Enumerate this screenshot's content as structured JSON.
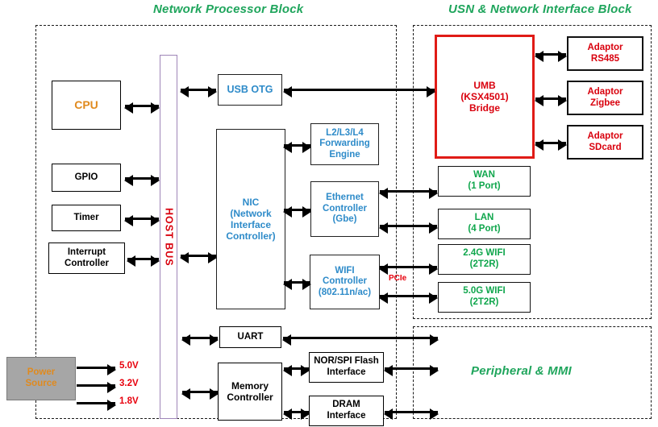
{
  "regions": {
    "network_processor": {
      "title": "Network Processor Block"
    },
    "usn": {
      "title": "USN & Network Interface Block"
    },
    "peripheral": {
      "title": "Peripheral & MMI"
    }
  },
  "host_bus": {
    "label": "HOST  BUS"
  },
  "blocks": {
    "cpu": "CPU",
    "gpio": "GPIO",
    "timer": "Timer",
    "interrupt_controller": "Interrupt\nController",
    "power_source": "Power\nSource",
    "usb_otg": "USB OTG",
    "nic": "NIC\n(Network\nInterface\nController)",
    "forwarding_engine": "L2/L3/L4\nForwarding\nEngine",
    "ethernet_controller": "Ethernet\nController\n(Gbe)",
    "wifi_controller": "WIFI\nController\n(802.11n/ac)",
    "uart": "UART",
    "memory_controller": "Memory\nController",
    "nor_spi_flash": "NOR/SPI Flash\nInterface",
    "dram": "DRAM\nInterface",
    "umb_bridge": "UMB\n(KSX4501)\nBridge",
    "adaptor_rs485": "Adaptor\nRS485",
    "adaptor_zigbee": "Adaptor\nZigbee",
    "adaptor_sdcard": "Adaptor\nSDcard",
    "wan": "WAN\n(1 Port)",
    "lan": "LAN\n(4 Port)",
    "wifi_24g": "2.4G WIFI\n(2T2R)",
    "wifi_50g": "5.0G WIFI\n(2T2R)"
  },
  "power_rails": [
    "5.0V",
    "3.2V",
    "1.8V"
  ],
  "bus_labels": {
    "pcie": "PCIe"
  },
  "colors": {
    "title_green": "#1FA55C",
    "block_blue": "#2E8BC9",
    "block_green": "#0FA64C",
    "block_red": "#D9000D",
    "umb_border": "#E01B16",
    "cpu_orange": "#E08A1E",
    "hostbus_border": "#9F86B8",
    "power_fill": "#A6A6A6",
    "rail_red": "#E8000D"
  }
}
